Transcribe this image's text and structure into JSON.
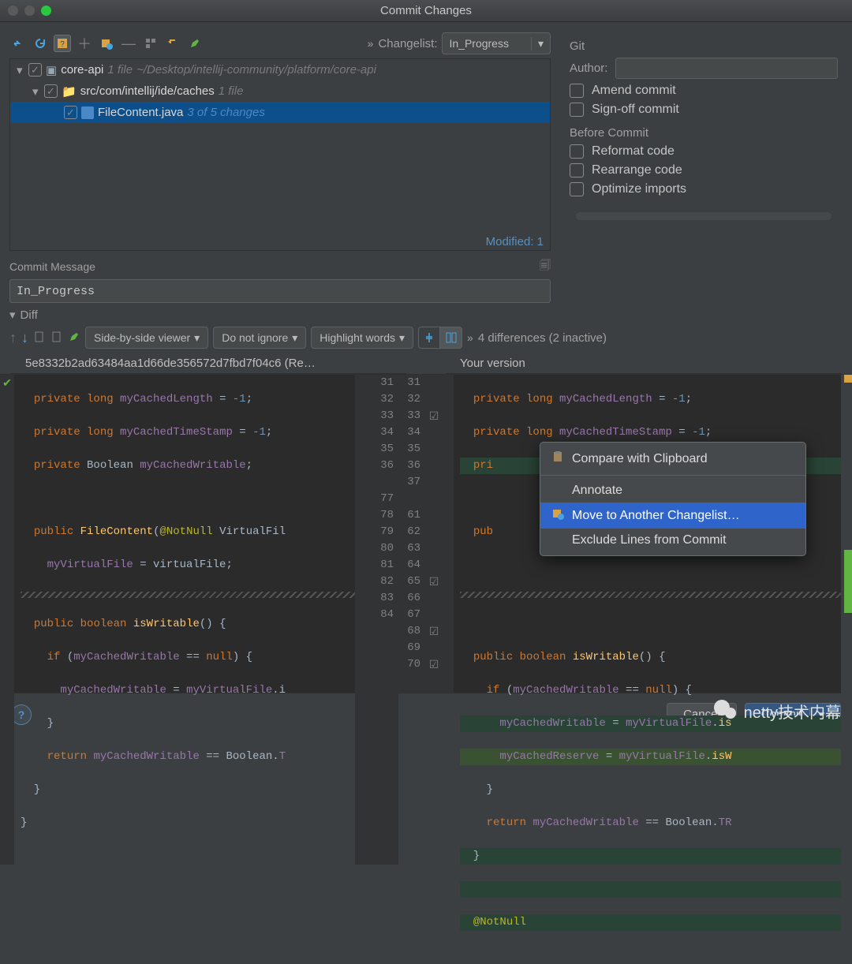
{
  "window": {
    "title": "Commit Changes"
  },
  "toolbar": {
    "changelist_label": "Changelist:",
    "changelist_value": "In_Progress"
  },
  "tree": {
    "root": {
      "name": "core-api",
      "files": "1 file",
      "path": "~/Desktop/intellij-community/platform/core-api"
    },
    "sub": {
      "name": "src/com/intellij/ide/caches",
      "files": "1 file"
    },
    "file": {
      "name": "FileContent.java",
      "changes": "3 of 5 changes"
    },
    "modified": "Modified: 1"
  },
  "commit": {
    "label": "Commit Message",
    "value": "In_Progress"
  },
  "diffheader": {
    "label": "Diff"
  },
  "difftoolbar": {
    "viewer": "Side-by-side viewer",
    "ignore": "Do not ignore",
    "highlight": "Highlight words",
    "summary": "4 differences (2 inactive)"
  },
  "diff": {
    "left_title": "5e8332b2ad63484aa1d66de356572d7fbd7f04c6 (Re…",
    "right_title": "Your version",
    "left_gutter": [
      "31",
      "32",
      "33",
      "34",
      "35",
      "36",
      "",
      "77",
      "78",
      "79",
      "80",
      "81",
      "82",
      "83",
      "84"
    ],
    "right_gutter": [
      "31",
      "32",
      "33",
      "34",
      "35",
      "36",
      "37",
      "",
      "61",
      "62",
      "63",
      "64",
      "65",
      "66",
      "67",
      "68",
      "69",
      "70"
    ],
    "right_checks": {
      "33": "✓",
      "65": "✓",
      "68": "✓",
      "70": "✓"
    }
  },
  "context_menu": {
    "compare": "Compare with Clipboard",
    "annotate": "Annotate",
    "move": "Move to Another Changelist…",
    "exclude": "Exclude Lines from Commit"
  },
  "rightpanel": {
    "git": "Git",
    "author": "Author:",
    "amend": "Amend commit",
    "signoff": "Sign-off commit",
    "before": "Before Commit",
    "reformat": "Reformat code",
    "rearrange": "Rearrange code",
    "optimize": "Optimize imports"
  },
  "buttons": {
    "cancel": "Cancel",
    "commit": "Commit",
    "help": "?"
  },
  "watermark": "netty技术内幕"
}
